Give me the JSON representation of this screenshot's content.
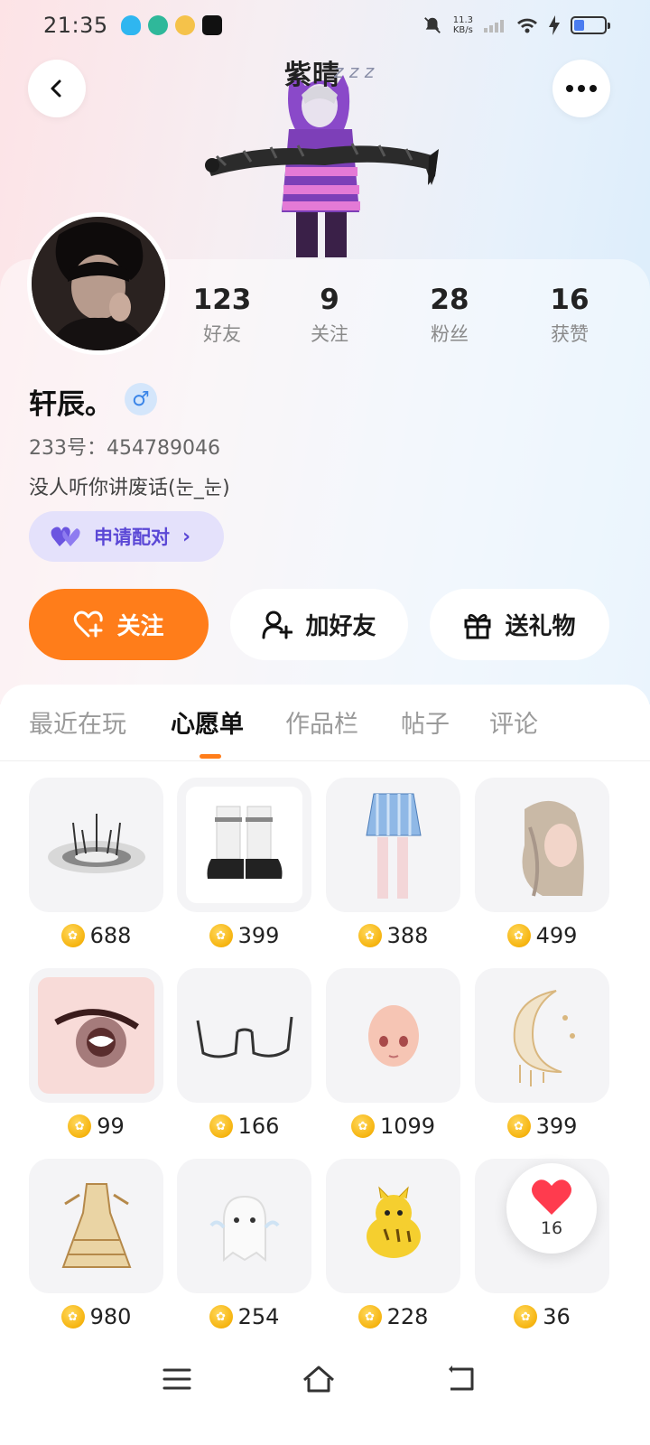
{
  "status_bar": {
    "time": "21:35",
    "net_speed_value": "11.3",
    "net_speed_unit": "KB/s",
    "battery_level": 0.3
  },
  "header": {
    "back_icon": "chevron-left-icon",
    "more_icon": "more-dots-icon",
    "figure_name": "紫晴",
    "figure_zzz": "z z z"
  },
  "profile": {
    "username": "轩辰。",
    "gender_symbol": "♂",
    "user_id": "233号：454789046",
    "bio": "没人听你讲废话(눈_눈)",
    "pair_label": "申请配对",
    "pair_chevron": "›"
  },
  "stats": [
    {
      "value": "123",
      "label": "好友"
    },
    {
      "value": "9",
      "label": "关注"
    },
    {
      "value": "28",
      "label": "粉丝"
    },
    {
      "value": "16",
      "label": "获赞"
    }
  ],
  "actions": {
    "follow": "关注",
    "add_friend": "加好友",
    "gift": "送礼物"
  },
  "tabs": [
    "最近在玩",
    "心愿单",
    "作品栏",
    "帖子",
    "评论"
  ],
  "active_tab": "心愿单",
  "wishlist": [
    {
      "price": "688",
      "icon": "halo-crown-item"
    },
    {
      "price": "399",
      "icon": "boots-item"
    },
    {
      "price": "388",
      "icon": "skirt-stockings-item"
    },
    {
      "price": "499",
      "icon": "wavy-hair-item"
    },
    {
      "price": "99",
      "icon": "eye-item"
    },
    {
      "price": "166",
      "icon": "glasses-item"
    },
    {
      "price": "1099",
      "icon": "face-head-item"
    },
    {
      "price": "399",
      "icon": "crescent-moon-item"
    },
    {
      "price": "980",
      "icon": "gold-dress-item"
    },
    {
      "price": "254",
      "icon": "ghost-item"
    },
    {
      "price": "228",
      "icon": "tiger-cat-item"
    },
    {
      "price": "36",
      "icon": "hidden-item"
    }
  ],
  "like_float": {
    "count": "16"
  },
  "nav": {
    "menu": "menu-icon",
    "home": "home-icon",
    "back": "back-icon"
  }
}
